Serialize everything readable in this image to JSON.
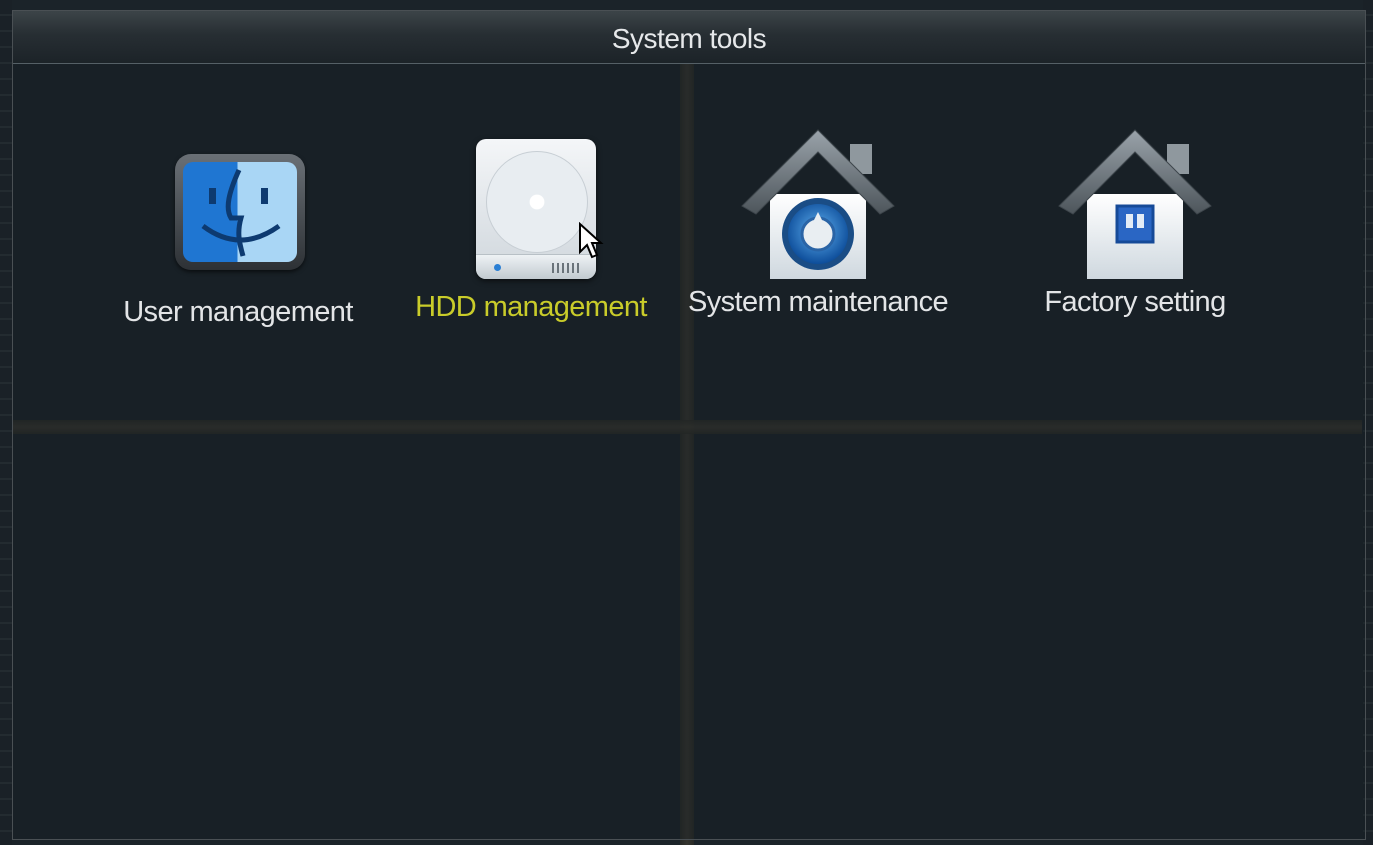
{
  "window": {
    "title": "System tools"
  },
  "tools": [
    {
      "label": "User management",
      "icon": "finder-face-icon",
      "selected": false
    },
    {
      "label": "HDD management",
      "icon": "hard-drive-icon",
      "selected": true
    },
    {
      "label": "System maintenance",
      "icon": "house-gear-icon",
      "selected": false
    },
    {
      "label": "Factory setting",
      "icon": "house-icon",
      "selected": false
    }
  ],
  "colors": {
    "background": "#1b2329",
    "selected_label": "#c9cc2a",
    "label": "#e3e5e7",
    "title": "#e6e8ea"
  }
}
